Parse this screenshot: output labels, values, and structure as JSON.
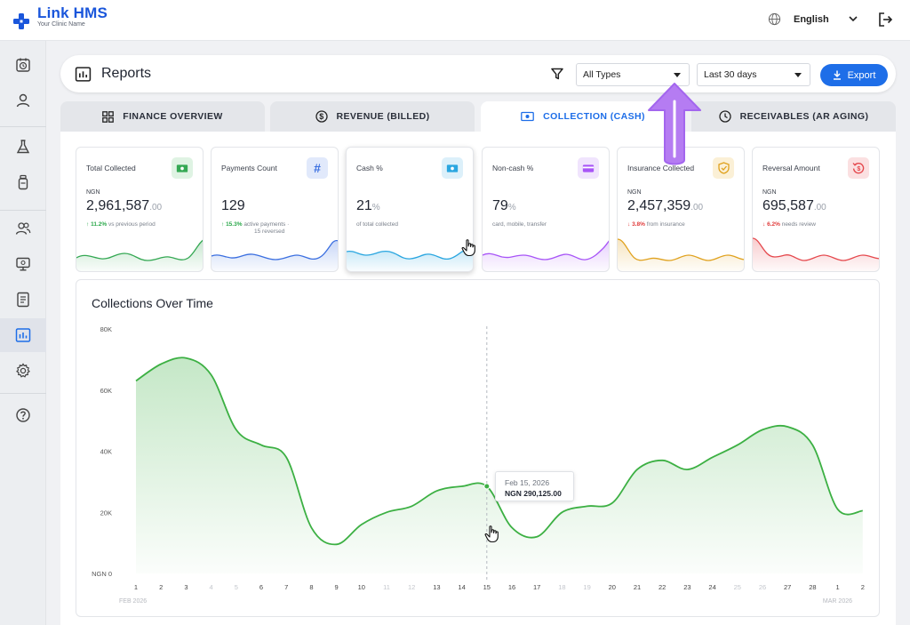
{
  "app": {
    "name": "Link HMS",
    "subtitle": "Your Clinic Name",
    "language": "English"
  },
  "sidebar": {
    "items": [
      {
        "icon": "calendar-clock-icon"
      },
      {
        "icon": "user-icon"
      },
      {
        "icon": "flask-icon"
      },
      {
        "icon": "bottle-icon"
      },
      {
        "icon": "users-icon"
      },
      {
        "icon": "monitor-icon"
      },
      {
        "icon": "document-icon"
      },
      {
        "icon": "reports-icon",
        "active": true
      },
      {
        "icon": "settings-icon"
      },
      {
        "icon": "help-icon"
      }
    ]
  },
  "header": {
    "title": "Reports",
    "type_filter": "All Types",
    "range_filter": "Last 30 days",
    "export_label": "Export"
  },
  "tabs": [
    {
      "label": "FINANCE OVERVIEW"
    },
    {
      "label": "REVENUE (BILLED)"
    },
    {
      "label": "COLLECTION (CASH)",
      "active": true
    },
    {
      "label": "RECEIVABLES (AR AGING)"
    }
  ],
  "kpis": [
    {
      "title": "Total Collected",
      "currency": "NGN",
      "value": "2,961,587",
      "decimals": ".00",
      "change": "11.2%",
      "direction": "up",
      "note": "vs previous period",
      "color": "#34a853",
      "icon": "cash-icon"
    },
    {
      "title": "Payments Count",
      "currency": "",
      "value": "129",
      "decimals": "",
      "change": "15.3%",
      "direction": "up",
      "note": "active payments ·",
      "note2": "15 reversed",
      "color": "#3b6fe0",
      "icon": "hash-icon"
    },
    {
      "title": "Cash %",
      "currency": "",
      "value": "21",
      "decimals": "%",
      "change": "",
      "direction": "",
      "note": "of total collected",
      "color": "#2aa6e0",
      "icon": "cash-icon"
    },
    {
      "title": "Non-cash %",
      "currency": "",
      "value": "79",
      "decimals": "%",
      "change": "",
      "direction": "",
      "note": "card, mobile, transfer",
      "color": "#a855f7",
      "icon": "card-icon"
    },
    {
      "title": "Insurance Collected",
      "currency": "NGN",
      "value": "2,457,359",
      "decimals": ".00",
      "change": "3.8%",
      "direction": "down",
      "note": "from insurance",
      "color": "#e0a21f",
      "icon": "shield-icon"
    },
    {
      "title": "Reversal Amount",
      "currency": "NGN",
      "value": "695,587",
      "decimals": ".00",
      "change": "6.2%",
      "direction": "down",
      "note": "needs review",
      "color": "#e5484d",
      "icon": "reversal-icon"
    }
  ],
  "chart_data": {
    "type": "area",
    "title": "Collections Over Time",
    "ylabel": "",
    "y_ticks": [
      "NGN 0",
      "20K",
      "40K",
      "60K",
      "80K"
    ],
    "ylim": [
      0,
      80000
    ],
    "x": [
      "1",
      "2",
      "3",
      "4",
      "5",
      "6",
      "7",
      "8",
      "9",
      "10",
      "11",
      "12",
      "13",
      "14",
      "15",
      "16",
      "17",
      "18",
      "19",
      "20",
      "21",
      "22",
      "23",
      "24",
      "25",
      "26",
      "27",
      "28",
      "1",
      "2"
    ],
    "x_faded": [
      false,
      false,
      false,
      true,
      true,
      false,
      false,
      false,
      false,
      false,
      true,
      true,
      false,
      false,
      false,
      false,
      false,
      true,
      true,
      false,
      false,
      false,
      false,
      false,
      true,
      true,
      false,
      false,
      false,
      false
    ],
    "month_start": "FEB 2026",
    "month_end": "MAR 2026",
    "series": [
      {
        "color": "#3cb043",
        "values": [
          63000,
          68500,
          70500,
          65000,
          47000,
          42000,
          38000,
          15000,
          9500,
          16000,
          20000,
          22000,
          27000,
          28500,
          28500,
          15000,
          12000,
          20000,
          22000,
          23000,
          34000,
          37000,
          34000,
          38000,
          42000,
          47000,
          48000,
          42000,
          21000,
          20500
        ]
      }
    ],
    "tooltip": {
      "date": "Feb 15, 2026",
      "value": "NGN 290,125.00",
      "index": 14
    }
  }
}
